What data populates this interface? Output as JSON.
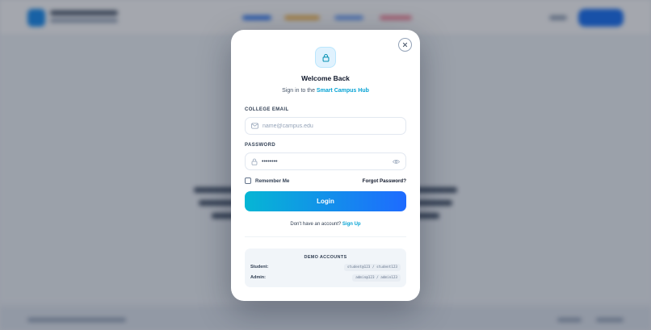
{
  "modal": {
    "title": "Welcome Back",
    "subtitle_prefix": "Sign in to the ",
    "subtitle_brand": "Smart Campus Hub",
    "email_label": "COLLEGE EMAIL",
    "email_placeholder": "name@campus.edu",
    "password_label": "PASSWORD",
    "password_value": "password",
    "remember_label": "Remember Me",
    "forgot_label": "Forgot Password?",
    "login_label": "Login",
    "signup_prompt": "Don't have an account? ",
    "signup_link": "Sign Up",
    "demo": {
      "title": "DEMO ACCOUNTS",
      "rows": [
        {
          "role": "Student:",
          "cred": "student@123 / student123"
        },
        {
          "role": "Admin:",
          "cred": "admin@123 / admin123"
        }
      ]
    }
  },
  "icons": {
    "close": "close-icon",
    "lock": "lock-icon",
    "mail": "mail-icon",
    "eye": "eye-icon"
  },
  "colors": {
    "accent": "#06a3d4",
    "button_start": "#06b6d4",
    "button_end": "#1e6bff",
    "overlay": "#0f172a"
  }
}
